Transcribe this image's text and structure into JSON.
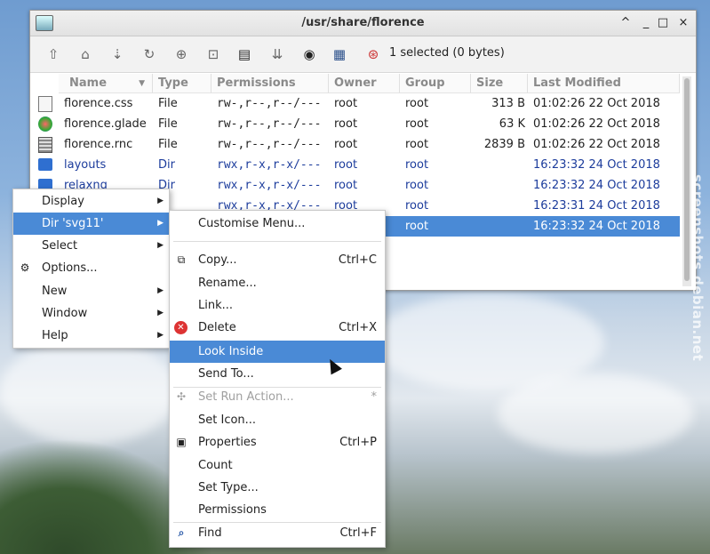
{
  "window": {
    "title": "/usr/share/florence",
    "selection_status": "1 selected (0 bytes)",
    "controls": [
      "^",
      "_",
      "□",
      "×"
    ]
  },
  "columns": [
    "Name",
    "Type",
    "Permissions",
    "Owner",
    "Group",
    "Size",
    "Last Modified"
  ],
  "files": [
    {
      "name": "florence.css",
      "type": "File",
      "perm": "rw-,r--,r--/---",
      "owner": "root",
      "group": "root",
      "size": "313 B",
      "modified": "01:02:26 22 Oct 2018",
      "icon": "document-icon"
    },
    {
      "name": "florence.glade",
      "type": "File",
      "perm": "rw-,r--,r--/---",
      "owner": "root",
      "group": "root",
      "size": "63 K",
      "modified": "01:02:26 22 Oct 2018",
      "icon": "glade-icon"
    },
    {
      "name": "florence.rnc",
      "type": "File",
      "perm": "rw-,r--,r--/---",
      "owner": "root",
      "group": "root",
      "size": "2839 B",
      "modified": "01:02:26 22 Oct 2018",
      "icon": "rnc-icon"
    },
    {
      "name": "layouts",
      "type": "Dir",
      "perm": "rwx,r-x,r-x/---",
      "owner": "root",
      "group": "root",
      "size": "",
      "modified": "16:23:32 24 Oct 2018",
      "icon": "folder-icon"
    },
    {
      "name": "relaxng",
      "type": "Dir",
      "perm": "rwx,r-x,r-x/---",
      "owner": "root",
      "group": "root",
      "size": "",
      "modified": "16:23:32 24 Oct 2018",
      "icon": "folder-icon"
    },
    {
      "name": "",
      "type": "",
      "perm": "rwx,r-x,r-x/---",
      "owner": "root",
      "group": "root",
      "size": "",
      "modified": "16:23:31 24 Oct 2018",
      "icon": ""
    },
    {
      "name": "",
      "type": "",
      "perm": "",
      "owner": "",
      "group": "root",
      "size": "",
      "modified": "16:23:32 24 Oct 2018",
      "icon": ""
    }
  ],
  "main_menu": [
    {
      "label": "Display",
      "submenu": true
    },
    {
      "label": "Dir 'svg11'",
      "submenu": true
    },
    {
      "label": "Select",
      "submenu": true
    },
    {
      "label": "Options...",
      "submenu": false
    },
    {
      "label": "New",
      "submenu": true
    },
    {
      "label": "Window",
      "submenu": true
    },
    {
      "label": "Help",
      "submenu": true
    }
  ],
  "dir_menu": {
    "customise": "Customise Menu...",
    "copy": {
      "label": "Copy...",
      "accel": "Ctrl+C"
    },
    "rename": "Rename...",
    "link": "Link...",
    "delete": {
      "label": "Delete",
      "accel": "Ctrl+X"
    },
    "look_inside": "Look Inside",
    "send_to": "Send To...",
    "set_run_action": {
      "label": "Set Run Action...",
      "accel": "*"
    },
    "set_icon": "Set Icon...",
    "properties": {
      "label": "Properties",
      "accel": "Ctrl+P"
    },
    "count": "Count",
    "set_type": "Set Type...",
    "permissions": "Permissions",
    "find": {
      "label": "Find",
      "accel": "Ctrl+F"
    }
  },
  "watermark": "screenshots.debian.net",
  "colors": {
    "selection": "#4a8ad6",
    "dir_text": "#1c3c9c"
  }
}
